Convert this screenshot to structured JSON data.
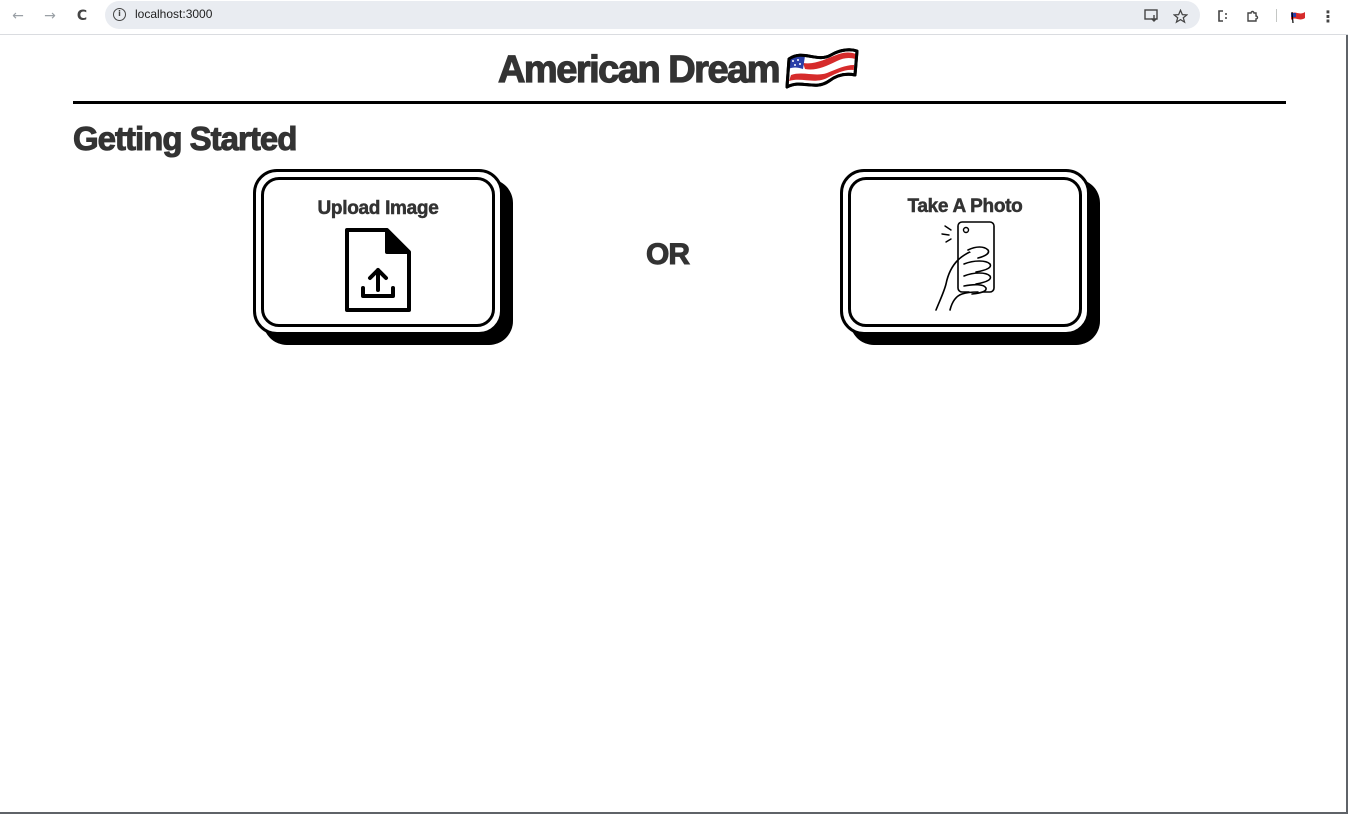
{
  "browser": {
    "url": "localhost:3000",
    "back_icon": "←",
    "forward_icon": "→",
    "reload_icon": "C",
    "info_icon": "i"
  },
  "header": {
    "title": "American Dream"
  },
  "section": {
    "title": "Getting Started"
  },
  "options": {
    "upload_label": "Upload Image",
    "photo_label": "Take A Photo",
    "separator": "OR"
  },
  "colors": {
    "text": "#333333",
    "border": "#000000",
    "flag_red": "#d62b2b",
    "flag_blue": "#2b3fa8"
  }
}
